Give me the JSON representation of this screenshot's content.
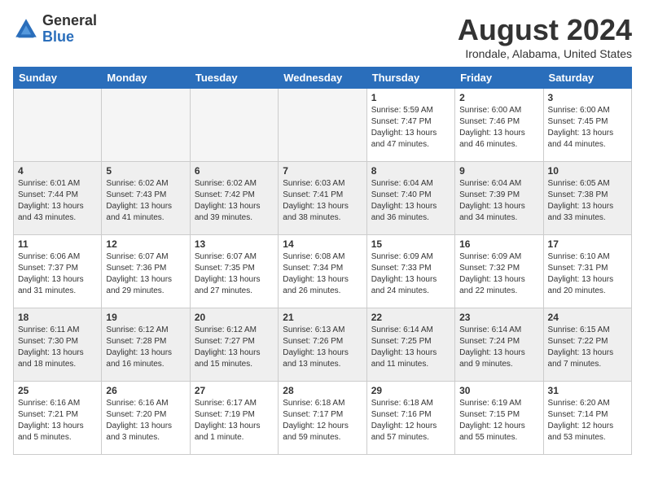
{
  "logo": {
    "general": "General",
    "blue": "Blue"
  },
  "title": "August 2024",
  "location": "Irondale, Alabama, United States",
  "days_header": [
    "Sunday",
    "Monday",
    "Tuesday",
    "Wednesday",
    "Thursday",
    "Friday",
    "Saturday"
  ],
  "weeks": [
    [
      {
        "day": "",
        "empty": true
      },
      {
        "day": "",
        "empty": true
      },
      {
        "day": "",
        "empty": true
      },
      {
        "day": "",
        "empty": true
      },
      {
        "day": "1",
        "sunrise": "Sunrise: 5:59 AM",
        "sunset": "Sunset: 7:47 PM",
        "daylight": "Daylight: 13 hours and 47 minutes."
      },
      {
        "day": "2",
        "sunrise": "Sunrise: 6:00 AM",
        "sunset": "Sunset: 7:46 PM",
        "daylight": "Daylight: 13 hours and 46 minutes."
      },
      {
        "day": "3",
        "sunrise": "Sunrise: 6:00 AM",
        "sunset": "Sunset: 7:45 PM",
        "daylight": "Daylight: 13 hours and 44 minutes."
      }
    ],
    [
      {
        "day": "4",
        "sunrise": "Sunrise: 6:01 AM",
        "sunset": "Sunset: 7:44 PM",
        "daylight": "Daylight: 13 hours and 43 minutes."
      },
      {
        "day": "5",
        "sunrise": "Sunrise: 6:02 AM",
        "sunset": "Sunset: 7:43 PM",
        "daylight": "Daylight: 13 hours and 41 minutes."
      },
      {
        "day": "6",
        "sunrise": "Sunrise: 6:02 AM",
        "sunset": "Sunset: 7:42 PM",
        "daylight": "Daylight: 13 hours and 39 minutes."
      },
      {
        "day": "7",
        "sunrise": "Sunrise: 6:03 AM",
        "sunset": "Sunset: 7:41 PM",
        "daylight": "Daylight: 13 hours and 38 minutes."
      },
      {
        "day": "8",
        "sunrise": "Sunrise: 6:04 AM",
        "sunset": "Sunset: 7:40 PM",
        "daylight": "Daylight: 13 hours and 36 minutes."
      },
      {
        "day": "9",
        "sunrise": "Sunrise: 6:04 AM",
        "sunset": "Sunset: 7:39 PM",
        "daylight": "Daylight: 13 hours and 34 minutes."
      },
      {
        "day": "10",
        "sunrise": "Sunrise: 6:05 AM",
        "sunset": "Sunset: 7:38 PM",
        "daylight": "Daylight: 13 hours and 33 minutes."
      }
    ],
    [
      {
        "day": "11",
        "sunrise": "Sunrise: 6:06 AM",
        "sunset": "Sunset: 7:37 PM",
        "daylight": "Daylight: 13 hours and 31 minutes."
      },
      {
        "day": "12",
        "sunrise": "Sunrise: 6:07 AM",
        "sunset": "Sunset: 7:36 PM",
        "daylight": "Daylight: 13 hours and 29 minutes."
      },
      {
        "day": "13",
        "sunrise": "Sunrise: 6:07 AM",
        "sunset": "Sunset: 7:35 PM",
        "daylight": "Daylight: 13 hours and 27 minutes."
      },
      {
        "day": "14",
        "sunrise": "Sunrise: 6:08 AM",
        "sunset": "Sunset: 7:34 PM",
        "daylight": "Daylight: 13 hours and 26 minutes."
      },
      {
        "day": "15",
        "sunrise": "Sunrise: 6:09 AM",
        "sunset": "Sunset: 7:33 PM",
        "daylight": "Daylight: 13 hours and 24 minutes."
      },
      {
        "day": "16",
        "sunrise": "Sunrise: 6:09 AM",
        "sunset": "Sunset: 7:32 PM",
        "daylight": "Daylight: 13 hours and 22 minutes."
      },
      {
        "day": "17",
        "sunrise": "Sunrise: 6:10 AM",
        "sunset": "Sunset: 7:31 PM",
        "daylight": "Daylight: 13 hours and 20 minutes."
      }
    ],
    [
      {
        "day": "18",
        "sunrise": "Sunrise: 6:11 AM",
        "sunset": "Sunset: 7:30 PM",
        "daylight": "Daylight: 13 hours and 18 minutes."
      },
      {
        "day": "19",
        "sunrise": "Sunrise: 6:12 AM",
        "sunset": "Sunset: 7:28 PM",
        "daylight": "Daylight: 13 hours and 16 minutes."
      },
      {
        "day": "20",
        "sunrise": "Sunrise: 6:12 AM",
        "sunset": "Sunset: 7:27 PM",
        "daylight": "Daylight: 13 hours and 15 minutes."
      },
      {
        "day": "21",
        "sunrise": "Sunrise: 6:13 AM",
        "sunset": "Sunset: 7:26 PM",
        "daylight": "Daylight: 13 hours and 13 minutes."
      },
      {
        "day": "22",
        "sunrise": "Sunrise: 6:14 AM",
        "sunset": "Sunset: 7:25 PM",
        "daylight": "Daylight: 13 hours and 11 minutes."
      },
      {
        "day": "23",
        "sunrise": "Sunrise: 6:14 AM",
        "sunset": "Sunset: 7:24 PM",
        "daylight": "Daylight: 13 hours and 9 minutes."
      },
      {
        "day": "24",
        "sunrise": "Sunrise: 6:15 AM",
        "sunset": "Sunset: 7:22 PM",
        "daylight": "Daylight: 13 hours and 7 minutes."
      }
    ],
    [
      {
        "day": "25",
        "sunrise": "Sunrise: 6:16 AM",
        "sunset": "Sunset: 7:21 PM",
        "daylight": "Daylight: 13 hours and 5 minutes."
      },
      {
        "day": "26",
        "sunrise": "Sunrise: 6:16 AM",
        "sunset": "Sunset: 7:20 PM",
        "daylight": "Daylight: 13 hours and 3 minutes."
      },
      {
        "day": "27",
        "sunrise": "Sunrise: 6:17 AM",
        "sunset": "Sunset: 7:19 PM",
        "daylight": "Daylight: 13 hours and 1 minute."
      },
      {
        "day": "28",
        "sunrise": "Sunrise: 6:18 AM",
        "sunset": "Sunset: 7:17 PM",
        "daylight": "Daylight: 12 hours and 59 minutes."
      },
      {
        "day": "29",
        "sunrise": "Sunrise: 6:18 AM",
        "sunset": "Sunset: 7:16 PM",
        "daylight": "Daylight: 12 hours and 57 minutes."
      },
      {
        "day": "30",
        "sunrise": "Sunrise: 6:19 AM",
        "sunset": "Sunset: 7:15 PM",
        "daylight": "Daylight: 12 hours and 55 minutes."
      },
      {
        "day": "31",
        "sunrise": "Sunrise: 6:20 AM",
        "sunset": "Sunset: 7:14 PM",
        "daylight": "Daylight: 12 hours and 53 minutes."
      }
    ]
  ]
}
